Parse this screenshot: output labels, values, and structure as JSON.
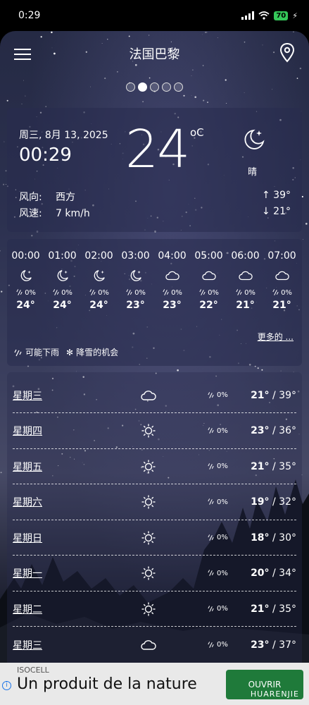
{
  "statusbar": {
    "time": "0:29",
    "battery": "70"
  },
  "header": {
    "city": "法国巴黎",
    "page_dots": 5,
    "active_dot": 1
  },
  "current": {
    "date": "周三, 8月 13, 2025",
    "time": "00:29",
    "temp": "24",
    "unit": "oC",
    "condition": "晴",
    "wind_dir_label": "风向:",
    "wind_dir": "西方",
    "wind_speed_label": "风速:",
    "wind_speed": "7 km/h",
    "high": "↑ 39°",
    "low": "↓ 21°",
    "icon": "moon-stars-icon"
  },
  "hourly": [
    {
      "time": "00:00",
      "icon": "moon",
      "precip": "0%",
      "temp": "24°"
    },
    {
      "time": "01:00",
      "icon": "moon",
      "precip": "0%",
      "temp": "24°"
    },
    {
      "time": "02:00",
      "icon": "moon",
      "precip": "0%",
      "temp": "24°"
    },
    {
      "time": "03:00",
      "icon": "moon",
      "precip": "0%",
      "temp": "23°"
    },
    {
      "time": "04:00",
      "icon": "cloud",
      "precip": "0%",
      "temp": "23°"
    },
    {
      "time": "05:00",
      "icon": "cloud",
      "precip": "0%",
      "temp": "22°"
    },
    {
      "time": "06:00",
      "icon": "cloud",
      "precip": "0%",
      "temp": "21°"
    },
    {
      "time": "07:00",
      "icon": "cloud",
      "precip": "0%",
      "temp": "21°"
    }
  ],
  "more_label": "更多的 ...",
  "legend": {
    "rain": "可能下雨",
    "snow": "降雪的机会"
  },
  "daily": [
    {
      "day": "星期三",
      "icon": "cloud",
      "precip": "0%",
      "low": "21°",
      "high": "39°"
    },
    {
      "day": "星期四",
      "icon": "sun",
      "precip": "0%",
      "low": "23°",
      "high": "36°"
    },
    {
      "day": "星期五",
      "icon": "sun",
      "precip": "0%",
      "low": "21°",
      "high": "35°"
    },
    {
      "day": "星期六",
      "icon": "sun",
      "precip": "0%",
      "low": "19°",
      "high": "32°"
    },
    {
      "day": "星期日",
      "icon": "sun",
      "precip": "0%",
      "low": "18°",
      "high": "30°"
    },
    {
      "day": "星期一",
      "icon": "sun",
      "precip": "0%",
      "low": "20°",
      "high": "34°"
    },
    {
      "day": "星期二",
      "icon": "sun",
      "precip": "0%",
      "low": "21°",
      "high": "35°"
    },
    {
      "day": "星期三",
      "icon": "cloud",
      "precip": "0%",
      "low": "23°",
      "high": "37°"
    }
  ],
  "ad": {
    "brand": "ISOCELL",
    "headline": "Un produit de la nature",
    "cta": "OUVRIR",
    "watermark": "HUARENJIE"
  }
}
